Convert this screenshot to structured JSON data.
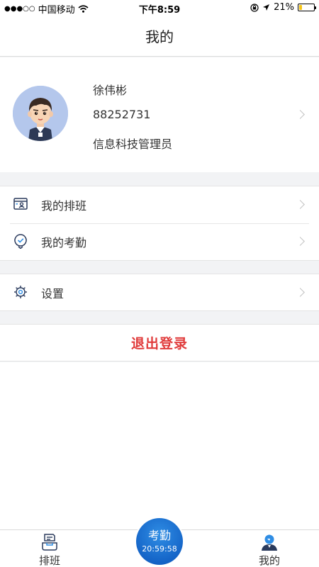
{
  "status_bar": {
    "signal": "●●●○○",
    "carrier": "中国移动",
    "time": "下午8:59",
    "battery_percent": "21%",
    "battery_level": 0.21,
    "battery_color": "#f5c518"
  },
  "navbar": {
    "title": "我的"
  },
  "profile": {
    "name": "徐伟彬",
    "id": "88252731",
    "role": "信息科技管理员"
  },
  "menu": {
    "schedule_label": "我的排班",
    "attendance_label": "我的考勤",
    "settings_label": "设置"
  },
  "logout": {
    "label": "退出登录",
    "color": "#e03a3a"
  },
  "tabbar": {
    "left_label": "排班",
    "right_label": "我的",
    "center_label": "考勤",
    "center_time": "20:59:58",
    "accent": "#1565c8"
  },
  "icons": [
    "wifi-icon",
    "lock-rotation-icon",
    "location-arrow-icon",
    "calendar-person-icon",
    "clock-pin-icon",
    "gear-icon",
    "chevron-right-icon",
    "schedule-tab-icon",
    "user-tab-icon"
  ]
}
